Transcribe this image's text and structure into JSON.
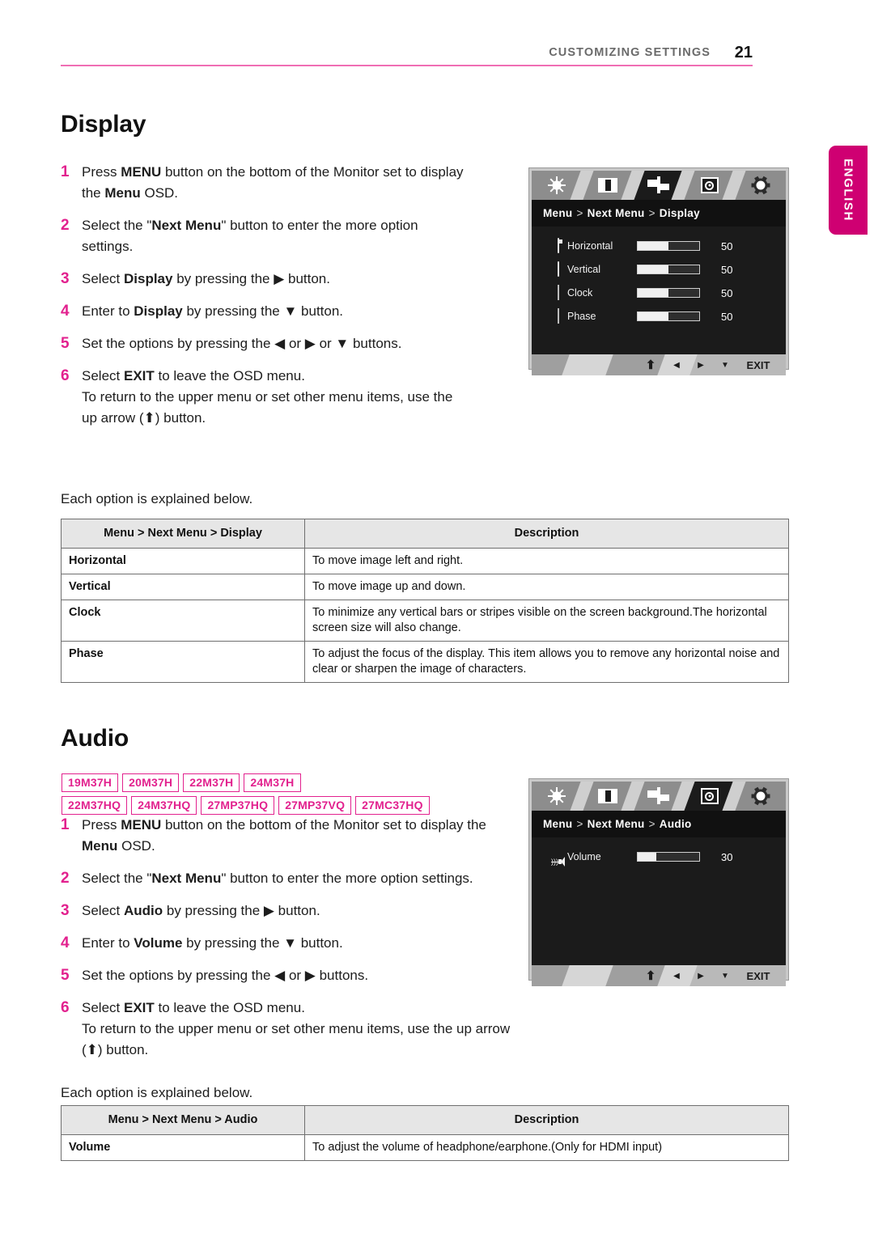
{
  "header": {
    "section_title": "CUSTOMIZING SETTINGS",
    "page_number": "21",
    "rule_color": "#f06eb4"
  },
  "language_tab": {
    "label": "ENGLISH",
    "color": "#cf0072"
  },
  "display_section": {
    "heading": "Display",
    "steps": [
      {
        "num": "1",
        "html": "Press <b>MENU</b> button on the bottom of the Monitor set to display the <b>Menu</b> OSD."
      },
      {
        "num": "2",
        "html": "Select the \"<b>Next Menu</b>\" button to enter the more option settings."
      },
      {
        "num": "3",
        "html": "Select <b>Display</b> by pressing the ▶ button."
      },
      {
        "num": "4",
        "html": "Enter to <b>Display</b> by pressing the ▼ button."
      },
      {
        "num": "5",
        "html": "Set the options by pressing the ◀ or ▶ or ▼ buttons."
      },
      {
        "num": "6",
        "html": "Select <b>EXIT</b> to leave the OSD menu.<br>To return to the upper menu or set other menu items, use the up arrow (⬆) button."
      }
    ],
    "note": "Each option is explained below.",
    "table": {
      "headers": [
        "Menu > Next Menu > Display",
        "Description"
      ],
      "rows": [
        [
          "Horizontal",
          "To move image left and right."
        ],
        [
          "Vertical",
          "To move image up and down."
        ],
        [
          "Clock",
          "To minimize any vertical bars or stripes visible on the screen background.The horizontal screen size will also change."
        ],
        [
          "Phase",
          "To adjust the focus of the display. This item allows you to remove any horizontal noise and clear or sharpen the image of characters."
        ]
      ]
    },
    "osd": {
      "breadcrumb": [
        "Menu",
        "Next Menu",
        "Display"
      ],
      "selected_tab_index": 2,
      "tab_icons": [
        "brightness-icon",
        "contrast-icon",
        "display-icon",
        "audio-disc-icon",
        "settings-gear-icon"
      ],
      "rows": [
        {
          "icon": "horizontal-icon",
          "label": "Horizontal",
          "value": "50",
          "fill_pct": 50
        },
        {
          "icon": "vertical-icon",
          "label": "Vertical",
          "value": "50",
          "fill_pct": 50
        },
        {
          "icon": "clock-icon",
          "label": "Clock",
          "value": "50",
          "fill_pct": 50
        },
        {
          "icon": "phase-icon",
          "label": "Phase",
          "value": "50",
          "fill_pct": 50
        }
      ],
      "footer": {
        "up": "⬆",
        "left": "◀",
        "right": "▶",
        "down": "▼",
        "exit": "EXIT"
      }
    }
  },
  "audio_section": {
    "heading": "Audio",
    "model_badges": [
      [
        "19M37H",
        "20M37H",
        "22M37H",
        "24M37H"
      ],
      [
        "22M37HQ",
        "24M37HQ",
        "27MP37HQ",
        "27MP37VQ",
        "27MC37HQ"
      ]
    ],
    "steps": [
      {
        "num": "1",
        "html": "Press <b>MENU</b> button on the bottom of the Monitor set to display the <b>Menu</b> OSD."
      },
      {
        "num": "2",
        "html": "Select the \"<b>Next Menu</b>\" button to enter the more option settings."
      },
      {
        "num": "3",
        "html": "Select <b>Audio</b> by pressing the ▶ button."
      },
      {
        "num": "4",
        "html": "Enter to <b>Volume</b> by pressing the ▼ button."
      },
      {
        "num": "5",
        "html": "Set the options by pressing the ◀ or ▶ buttons."
      },
      {
        "num": "6",
        "html": "Select <b>EXIT</b> to leave the OSD menu.<br>To return to the upper menu or set other menu items, use the up arrow (⬆) button."
      }
    ],
    "note": "Each option is explained below.",
    "table": {
      "headers": [
        "Menu > Next Menu > Audio",
        "Description"
      ],
      "rows": [
        [
          "Volume",
          "To adjust the volume of headphone/earphone.(Only for HDMI input)"
        ]
      ]
    },
    "osd": {
      "breadcrumb": [
        "Menu",
        "Next Menu",
        "Audio"
      ],
      "selected_tab_index": 3,
      "tab_icons": [
        "brightness-icon",
        "contrast-icon",
        "display-icon",
        "audio-disc-icon",
        "settings-gear-icon"
      ],
      "rows": [
        {
          "icon": "speaker-icon",
          "label": "Volume",
          "value": "30",
          "fill_pct": 30
        }
      ],
      "footer": {
        "up": "⬆",
        "left": "◀",
        "right": "▶",
        "down": "▼",
        "exit": "EXIT"
      }
    }
  }
}
